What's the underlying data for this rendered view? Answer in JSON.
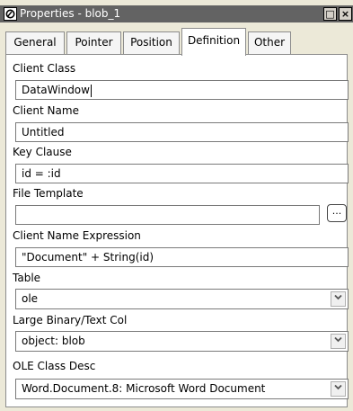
{
  "window": {
    "title": "Properties - blob_1",
    "maximize_glyph": "□",
    "close_glyph": "×"
  },
  "tabs": [
    {
      "label": "General"
    },
    {
      "label": "Pointer"
    },
    {
      "label": "Position"
    },
    {
      "label": "Definition",
      "active": true
    },
    {
      "label": "Other"
    }
  ],
  "fields": {
    "client_class": {
      "label": "Client Class",
      "value": "DataWindow"
    },
    "client_name": {
      "label": "Client Name",
      "value": "Untitled"
    },
    "key_clause": {
      "label": "Key Clause",
      "value": "id = :id"
    },
    "file_template": {
      "label": "File Template",
      "value": "",
      "browse_label": "..."
    },
    "client_name_expression": {
      "label": "Client Name Expression",
      "value": "\"Document\" + String(id)"
    },
    "table": {
      "label": "Table",
      "value": "ole"
    },
    "large_binary_text_col": {
      "label": "Large Binary/Text Col",
      "value": "object: blob"
    },
    "ole_class_desc": {
      "label": "OLE Class Desc",
      "value": "Word.Document.8: Microsoft Word Document"
    }
  },
  "icons": {
    "dropdown": "chevron-down-icon",
    "title": "properties-icon"
  },
  "dropdown_glyph": "﹀"
}
